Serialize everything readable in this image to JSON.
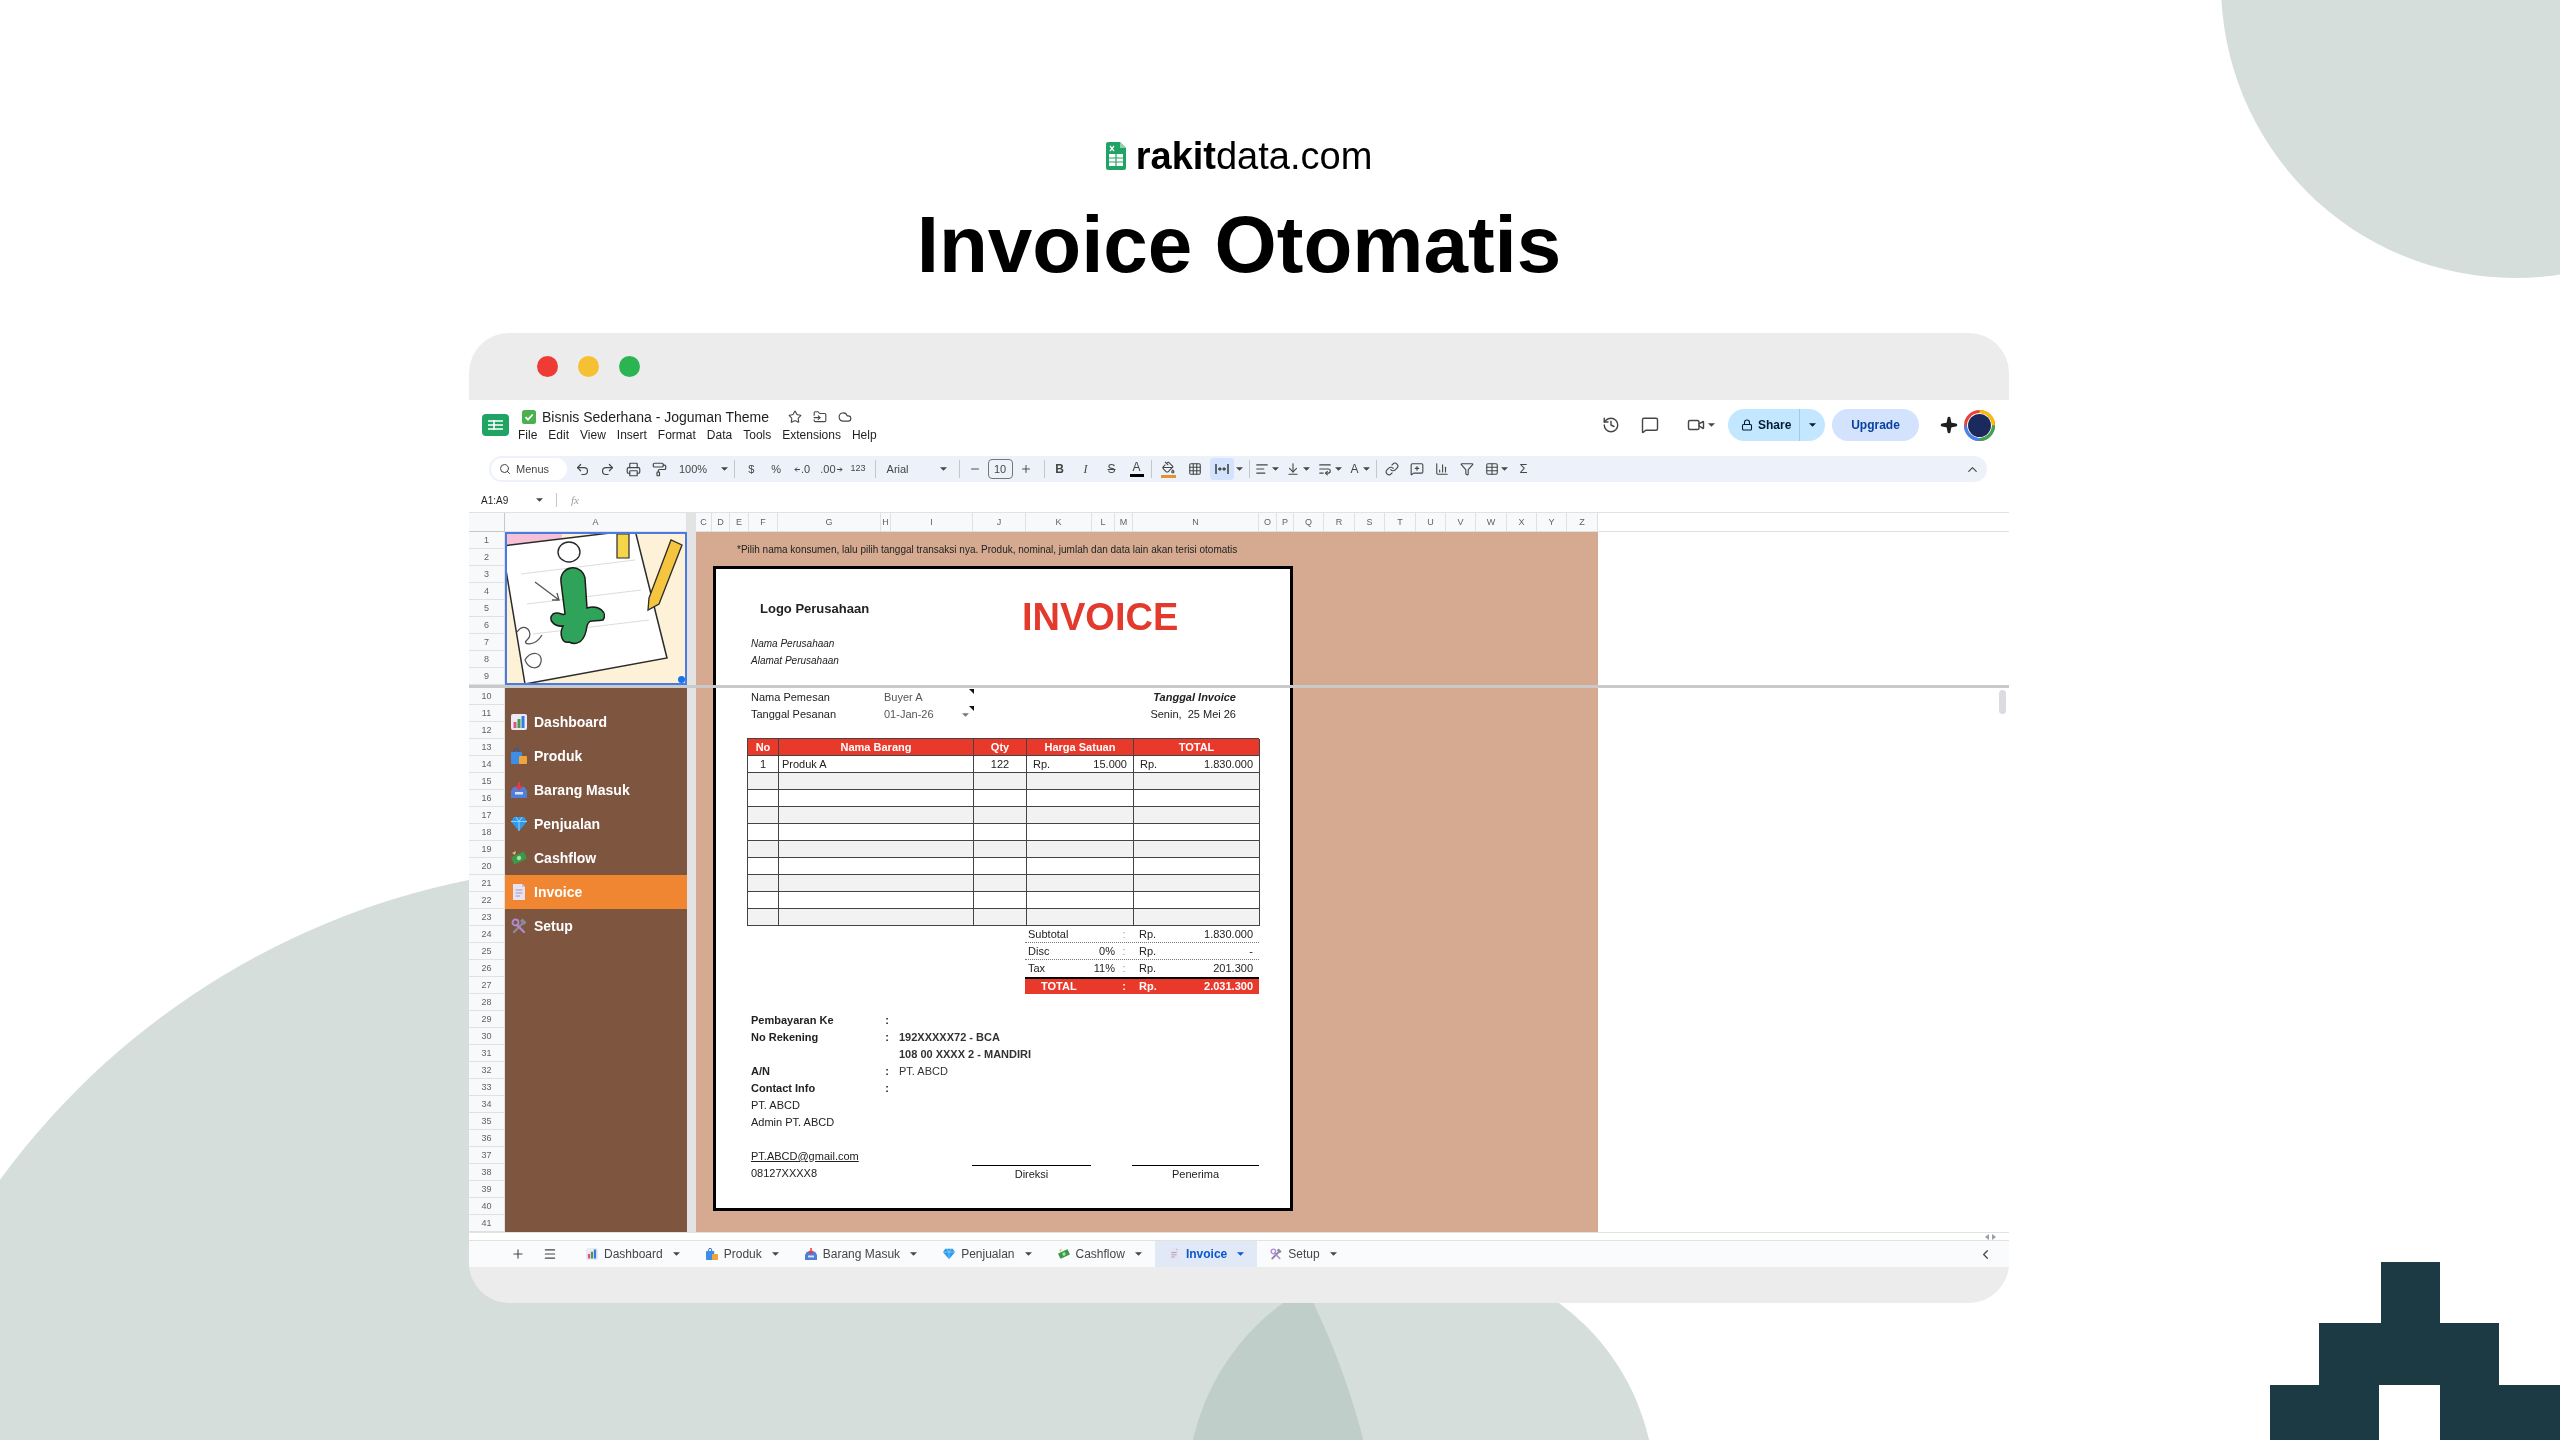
{
  "brand": {
    "name": "**rakit**data.com"
  },
  "title": "Invoice Otomatis",
  "sheets": {
    "doc_title": "Bisnis Sederhana - Joguman Theme",
    "menu": [
      "File",
      "Edit",
      "View",
      "Insert",
      "Format",
      "Data",
      "Tools",
      "Extensions",
      "Help"
    ],
    "share": "Share",
    "upgrade": "Upgrade",
    "toolbar": {
      "search": {
        "placeholder": "Menus"
      },
      "zoom": "100%",
      "currency": "$",
      "percent": "%",
      "decrease_decimal": ".0",
      "increase_decimal": ".00",
      "number_format": "123",
      "font": "Arial",
      "font_size": "10",
      "bold": "B",
      "italic": "I",
      "strikethrough": "S",
      "text_color": "A",
      "text_rotation": "A",
      "merge_active": true,
      "functions": "Σ"
    },
    "name_box": "A1:A9",
    "formula_label": "fx",
    "columns": [
      "A",
      "C",
      "D",
      "E",
      "F",
      "G",
      "H",
      "I",
      "J",
      "K",
      "L",
      "M",
      "N",
      "O",
      "P",
      "Q",
      "R",
      "S",
      "T",
      "U",
      "V",
      "W",
      "X",
      "Y",
      "Z"
    ],
    "rows": [
      "1",
      "2",
      "3",
      "4",
      "5",
      "6",
      "7",
      "8",
      "9",
      "10",
      "11",
      "12",
      "13",
      "14",
      "15",
      "16",
      "17",
      "18",
      "19",
      "20",
      "21",
      "22",
      "23",
      "24",
      "25",
      "26",
      "27",
      "28",
      "29",
      "30",
      "31",
      "32",
      "33",
      "34",
      "35",
      "36",
      "37",
      "38",
      "39",
      "40",
      "41"
    ],
    "sidebar": [
      {
        "label": "Dashboard",
        "selected": false
      },
      {
        "label": "Produk",
        "selected": false
      },
      {
        "label": "Barang Masuk",
        "selected": false
      },
      {
        "label": "Penjualan",
        "selected": false
      },
      {
        "label": "Cashflow",
        "selected": false
      },
      {
        "label": "Invoice",
        "selected": true
      },
      {
        "label": "Setup",
        "selected": false
      }
    ],
    "instruction": "*Pilih nama konsumen, lalu pilih tanggal transaksi nya. Produk, nominal, jumlah dan data lain akan terisi otomatis",
    "invoice": {
      "logo": "Logo Perusahaan",
      "heading": "INVOICE",
      "company": [
        "Nama Perusahaan",
        "Alamat Perusahaan"
      ],
      "customer": [
        {
          "kind": "text",
          "label": "Nama Pemesan",
          "value": "Buyer A"
        },
        {
          "kind": "dropdown",
          "label": "Tanggal Pesanan",
          "value": "01-Jan-26"
        }
      ],
      "date": {
        "label": "Tanggal Invoice",
        "value": "Senin,  25 Mei 26"
      },
      "table": {
        "columns": [
          "No",
          "Nama Barang",
          "Qty",
          "Harga Satuan",
          "TOTAL"
        ],
        "rows": [
          {
            "no": "1",
            "item": "Produk A",
            "qty": "122",
            "price_currency": "Rp.",
            "price": "15.000",
            "total_currency": "Rp.",
            "total": "1.830.000"
          }
        ]
      },
      "summary": [
        {
          "kind": "line",
          "label": "Subtotal",
          "separator": ":",
          "currency": "Rp.",
          "value": "1.830.000"
        },
        {
          "kind": "line",
          "label": "Disc",
          "rate": "0%",
          "separator": ":",
          "currency": "Rp.",
          "value": "-"
        },
        {
          "kind": "line",
          "label": "Tax",
          "rate": "11%",
          "separator": ":",
          "currency": "Rp.",
          "value": "201.300"
        },
        {
          "kind": "total",
          "label": "TOTAL",
          "separator": ":",
          "currency": "Rp.",
          "value": "2.031.300"
        }
      ],
      "payment": [
        {
          "label": "Pembayaran Ke",
          "separator": ":"
        },
        {
          "kind": "account",
          "label": "No Rekening",
          "separator": ":",
          "value": "192XXXXX72 - BCA"
        },
        {
          "kind": "account",
          "value": "108 00 XXXX 2 - MANDIRI"
        },
        {
          "kind": "plain",
          "label": "A/N",
          "separator": ":",
          "value": "PT. ABCD"
        },
        {
          "label": "Contact Info",
          "separator": ":"
        }
      ],
      "contact": [
        "PT. ABCD",
        "Admin PT. ABCD"
      ],
      "email": "PT.ABCD@gmail.com",
      "phone": "08127XXXX8",
      "signatures": [
        "Direksi",
        "Penerima"
      ]
    },
    "sheet_tabs": [
      {
        "label": "Dashboard",
        "selected": false
      },
      {
        "label": "Produk",
        "selected": false
      },
      {
        "label": "Barang Masuk",
        "selected": false
      },
      {
        "label": "Penjualan",
        "selected": false
      },
      {
        "label": "Cashflow",
        "selected": false
      },
      {
        "label": "Invoice",
        "selected": true
      },
      {
        "label": "Setup",
        "selected": false
      }
    ]
  }
}
